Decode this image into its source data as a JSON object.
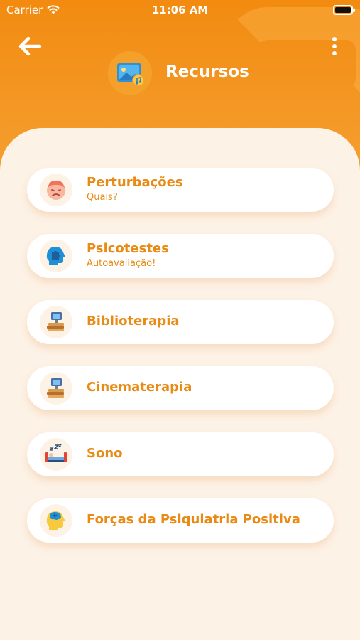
{
  "status_bar": {
    "carrier": "Carrier",
    "time": "11:06 AM"
  },
  "header": {
    "title": "Recursos",
    "back_icon": "arrow-left-icon",
    "menu_icon": "more-vertical-icon",
    "title_icon": "media-image-icon"
  },
  "colors": {
    "header_orange": "#f28b10",
    "accent_text": "#e88a14",
    "background": "#fdf2e6",
    "card": "#ffffff"
  },
  "menu": {
    "items": [
      {
        "label": "Perturbações",
        "subtitle": "Quais?",
        "icon": "sad-face-icon"
      },
      {
        "label": "Psicotestes",
        "subtitle": "Autoavaliação!",
        "icon": "head-puzzle-icon"
      },
      {
        "label": "Biblioterapia",
        "icon": "books-computer-icon"
      },
      {
        "label": "Cinematerapia",
        "icon": "books-computer-icon"
      },
      {
        "label": "Sono",
        "icon": "sleeping-bed-icon"
      },
      {
        "label": "Forças da Psiquiatria Positiva",
        "icon": "head-brain-icon"
      }
    ]
  }
}
